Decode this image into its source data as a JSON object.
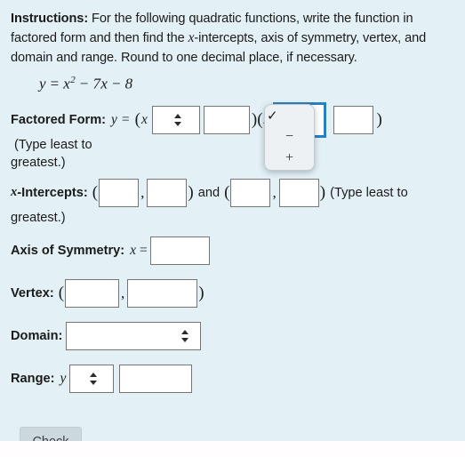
{
  "page": {
    "background_color": "#e3f0f5",
    "instructions": {
      "label": "Instructions:",
      "text_part1": " For the following quadratic functions, write the function in factored form and then find the ",
      "var_x": "x",
      "text_part2": "-intercepts, axis of symmetry, vertex, and domain and range.  Round to one decimal place, if necessary."
    },
    "equation": {
      "lhs": "y",
      "eq": "=",
      "x": "x",
      "exponent": "2",
      "minus1": "−",
      "term2": "7x",
      "minus2": "−",
      "term3": "8",
      "full": "y = x² − 7x − 8"
    }
  },
  "factored_form": {
    "label": "Factored Form:",
    "y": "y",
    "equals": "=",
    "open_paren_1": "(",
    "x_var_1": "x",
    "sign_select_1_value": "",
    "number_input_1_value": "",
    "number_input_1_placeholder": "",
    "close_open": ")(",
    "x_var_2": "x",
    "sign_select_2_value": "",
    "number_input_2_value": "",
    "close_paren_2": ")",
    "note": " (Type least to",
    "note_continued": "greatest.)"
  },
  "sign_dropdown": {
    "open": true,
    "options": [
      {
        "label": "",
        "icon": "checkmark-icon",
        "selected": true
      },
      {
        "label": "−",
        "icon": "minus-glyph",
        "selected": false
      },
      {
        "label": "+",
        "icon": "plus-glyph",
        "selected": false
      }
    ],
    "check_glyph": "✓",
    "focus_ring_color": "#2a7fc1",
    "popup_background": "#eef1f3"
  },
  "x_intercepts": {
    "label_var": "x",
    "label": "-Intercepts:",
    "open_paren_1": "(",
    "value_1": "",
    "comma_1": ",",
    "value_2": "",
    "close_paren_1": ")",
    "and": " and ",
    "open_paren_2": "(",
    "value_3": "",
    "comma_2": ",",
    "value_4": "",
    "close_paren_2": ")",
    "note": " (Type least to",
    "note_continued": "greatest.)"
  },
  "axis_of_symmetry": {
    "label": "Axis of Symmetry:",
    "var_x": "x",
    "equals": "=",
    "value": ""
  },
  "vertex": {
    "label": "Vertex:",
    "open_paren": "(",
    "value_x": "",
    "comma": ",",
    "value_y": "",
    "close_paren": ")"
  },
  "domain": {
    "label": "Domain:",
    "select_value": ""
  },
  "range": {
    "label": "Range:",
    "var_y": "y",
    "select_value": "",
    "input_value": ""
  },
  "actions": {
    "check_label": "Check"
  }
}
